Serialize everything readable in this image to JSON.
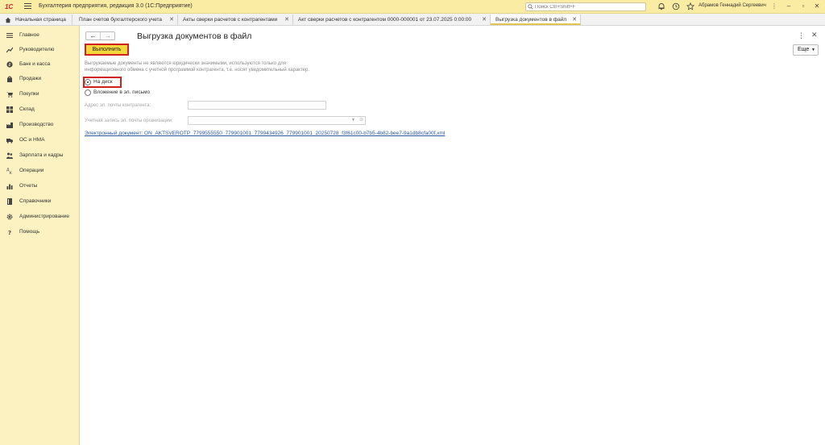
{
  "app": {
    "logo": "1С",
    "title": "Бухгалтерия предприятия, редакция 3.0  (1С:Предприятие)",
    "search_placeholder": "Поиск Ctrl+Shift+F",
    "user": "Абрамов Геннадий Сергеевич"
  },
  "tabs": [
    {
      "label": "Начальная страница",
      "closable": false
    },
    {
      "label": "План счетов бухгалтерского учета",
      "closable": true
    },
    {
      "label": "Акты сверки расчетов с контрагентами",
      "closable": true
    },
    {
      "label": "Акт сверки расчетов с контрагентом 0000-000001 от 23.07.2025 0:00:00",
      "closable": true
    },
    {
      "label": "Выгрузка документов в файл",
      "closable": true,
      "active": true
    }
  ],
  "sidebar": {
    "items": [
      {
        "label": "Главное",
        "icon": "menu-icon"
      },
      {
        "label": "Руководителю",
        "icon": "trend-icon"
      },
      {
        "label": "Банк и касса",
        "icon": "bank-icon"
      },
      {
        "label": "Продажи",
        "icon": "bag-icon"
      },
      {
        "label": "Покупки",
        "icon": "cart-icon"
      },
      {
        "label": "Склад",
        "icon": "warehouse-icon"
      },
      {
        "label": "Производство",
        "icon": "factory-icon"
      },
      {
        "label": "ОС и НМА",
        "icon": "truck-icon"
      },
      {
        "label": "Зарплата и кадры",
        "icon": "people-icon"
      },
      {
        "label": "Операции",
        "icon": "operations-icon"
      },
      {
        "label": "Отчеты",
        "icon": "chart-icon"
      },
      {
        "label": "Справочники",
        "icon": "book-icon"
      },
      {
        "label": "Администрирование",
        "icon": "gear-icon"
      },
      {
        "label": "Помощь",
        "icon": "question-icon"
      }
    ]
  },
  "form": {
    "title": "Выгрузка документов в файл",
    "run_button": "Выполнить",
    "more_button": "Еще",
    "info_line1": "Выгружаемые документы не являются юридически значимыми, используются только для",
    "info_line2": "информационного обмена с учетной программой контрагента, т.е. носят уведомительный характер.",
    "option_disk": "На диск",
    "option_email": "Вложение в эл. письмо",
    "selected_option": "disk",
    "email_label": "Адрес эл. почты контрагента:",
    "email_value": "",
    "account_label": "Учетная запись эл. почты организации:",
    "account_value": "",
    "doc_link": "Электронный документ: ON_AKTSVEROTP_7799555550_779901001_7799434926_779901001_20250728_f3f61c00-b7b5-4b82-bee7-9a1db8cfa00f.xml"
  },
  "colors": {
    "titlebar": "#fbeca4",
    "sidebar": "#fbf1c1",
    "accent_button": "#f3d63b",
    "highlight": "#d02020",
    "link": "#2a5aa8"
  }
}
